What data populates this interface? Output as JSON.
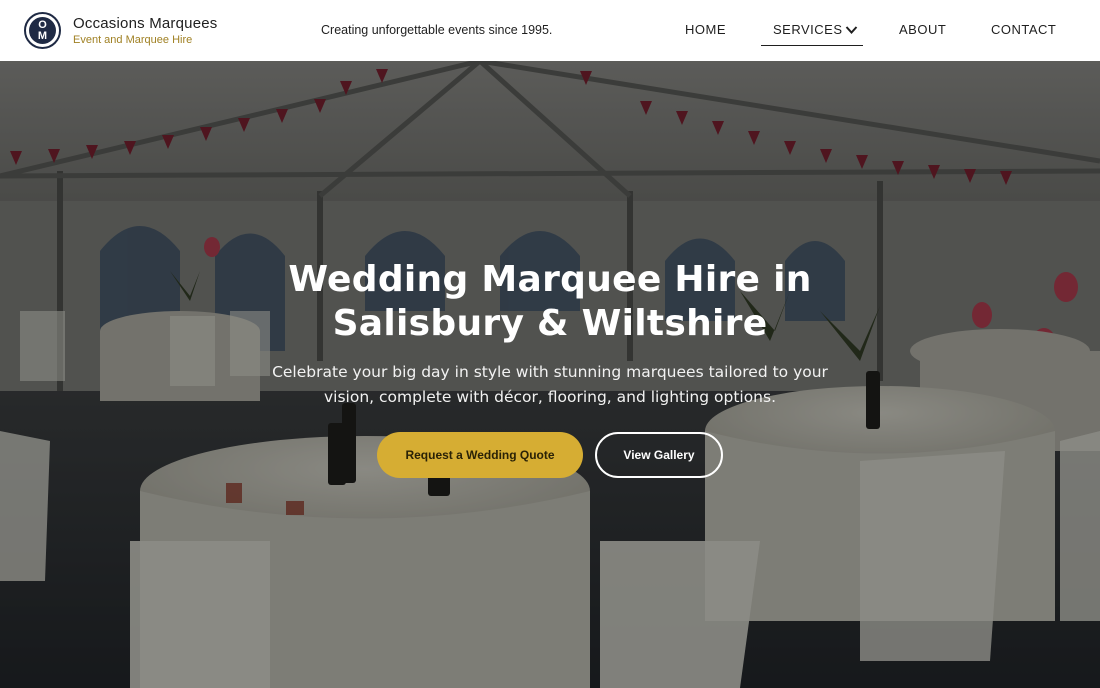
{
  "brand": {
    "logo_letters": [
      "O",
      "M"
    ],
    "name": "Occasions Marquees",
    "subtitle": "Event and Marquee Hire"
  },
  "header": {
    "tagline": "Creating unforgettable events since 1995."
  },
  "nav": {
    "home": "HOME",
    "services": "SERVICES",
    "about": "ABOUT",
    "contact": "CONTACT"
  },
  "hero": {
    "title_line1": "Wedding Marquee Hire in",
    "title_line2": "Salisbury & Wiltshire",
    "desc_line1": "Celebrate your big day in style with stunning marquees tailored to your",
    "desc_line2": "vision, complete with décor, flooring, and lighting options.",
    "primary_button": "Request a Wedding Quote",
    "secondary_button": "View Gallery",
    "background_image": "marquee-interior-photo"
  },
  "colors": {
    "accent_gold": "#d6ad33",
    "brand_navy": "#1f2a44",
    "subtitle_gold": "#a08124",
    "bunting_red": "#7a1c2c"
  },
  "icons": {
    "services_dropdown": "chevron-down-icon"
  }
}
